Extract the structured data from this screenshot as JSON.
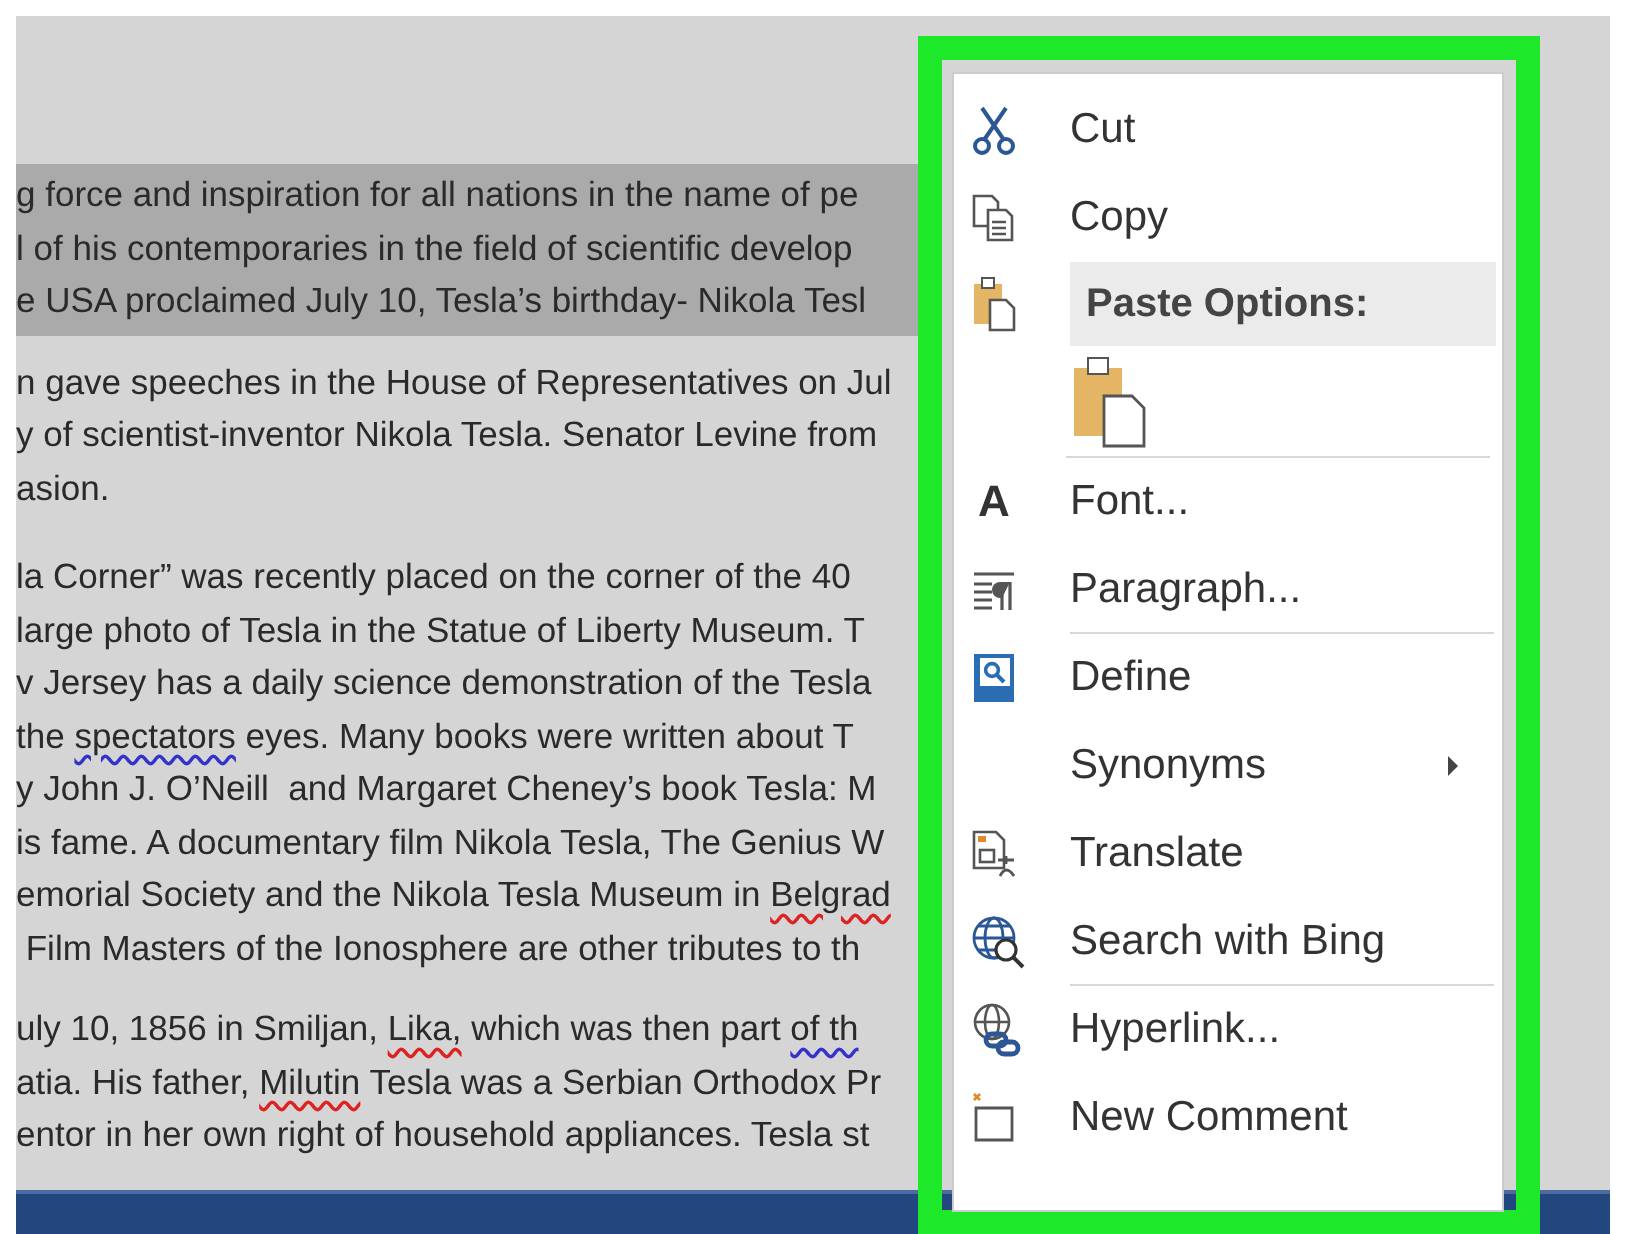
{
  "document": {
    "paragraphs": [
      {
        "selected": true,
        "lines": [
          [
            {
              "kind": "plain",
              "text": "g force and inspiration for all nations in the name of pe"
            }
          ],
          [
            {
              "kind": "plain",
              "text": "l of his contemporaries in the field of scientific develop"
            }
          ],
          [
            {
              "kind": "plain",
              "text": "e USA proclaimed July 10, Tesla’s birthday- Nikola Tesl"
            }
          ]
        ]
      },
      {
        "selected": false,
        "lines": [
          [
            {
              "kind": "plain",
              "text": "n gave speeches in the House of Representatives on Jul"
            }
          ],
          [
            {
              "kind": "plain",
              "text": "y of scientist-inventor Nikola Tesla. Senator Levine from"
            }
          ],
          [
            {
              "kind": "plain",
              "text": "asion."
            }
          ]
        ]
      },
      {
        "selected": false,
        "lines": [
          [
            {
              "kind": "plain",
              "text": "la Corner” was recently placed on the corner of the 40"
            }
          ],
          [
            {
              "kind": "plain",
              "text": "large photo of Tesla in the Statue of Liberty Museum. T"
            }
          ],
          [
            {
              "kind": "plain",
              "text": "v Jersey has a daily science demonstration of the Tesla"
            }
          ],
          [
            {
              "kind": "plain",
              "text": "the "
            },
            {
              "kind": "grammar",
              "text": "spectators"
            },
            {
              "kind": "plain",
              "text": " eyes. Many books were written about T"
            }
          ],
          [
            {
              "kind": "plain",
              "text": "y John J. O’Neill  and Margaret Cheney’s book Tesla: M"
            }
          ],
          [
            {
              "kind": "plain",
              "text": "is fame. A documentary film Nikola Tesla, The Genius W"
            }
          ],
          [
            {
              "kind": "plain",
              "text": "emorial Society and the Nikola Tesla Museum in "
            },
            {
              "kind": "spelling",
              "text": "Belgrad"
            }
          ],
          [
            {
              "kind": "plain",
              "text": " Film Masters of the Ionosphere are other tributes to th"
            }
          ]
        ]
      },
      {
        "selected": false,
        "lines": [
          [
            {
              "kind": "plain",
              "text": "uly 10, 1856 in Smiljan, "
            },
            {
              "kind": "spelling",
              "text": "Lika,"
            },
            {
              "kind": "plain",
              "text": " which was then part "
            },
            {
              "kind": "grammar",
              "text": "of th"
            }
          ],
          [
            {
              "kind": "plain",
              "text": "atia. His father, "
            },
            {
              "kind": "spelling",
              "text": "Milutin"
            },
            {
              "kind": "plain",
              "text": " Tesla was a Serbian Orthodox Pr"
            }
          ],
          [
            {
              "kind": "plain",
              "text": "entor in her own right of household appliances. Tesla st"
            }
          ]
        ]
      }
    ]
  },
  "context_menu": {
    "items": [
      {
        "kind": "item",
        "label": "Cut",
        "submenu": false,
        "separator_after": false
      },
      {
        "kind": "item",
        "label": "Copy",
        "submenu": false,
        "separator_after": false
      },
      {
        "kind": "header",
        "label": "Paste Options:",
        "separator_after": false
      },
      {
        "kind": "paste-button",
        "separator_after": true
      },
      {
        "kind": "item",
        "label": "Font...",
        "icon_text": "A",
        "submenu": false,
        "separator_after": false
      },
      {
        "kind": "item",
        "label": "Paragraph...",
        "submenu": false,
        "separator_after": true
      },
      {
        "kind": "item",
        "label": "Define",
        "submenu": false,
        "separator_after": false
      },
      {
        "kind": "item",
        "label": "Synonyms",
        "submenu": true,
        "separator_after": false
      },
      {
        "kind": "item",
        "label": "Translate",
        "submenu": false,
        "separator_after": false
      },
      {
        "kind": "item",
        "label": "Search with Bing",
        "submenu": false,
        "separator_after": true
      },
      {
        "kind": "item",
        "label": "Hyperlink...",
        "submenu": false,
        "separator_after": false
      },
      {
        "kind": "item",
        "label": "New Comment",
        "submenu": false,
        "separator_after": false
      }
    ]
  }
}
